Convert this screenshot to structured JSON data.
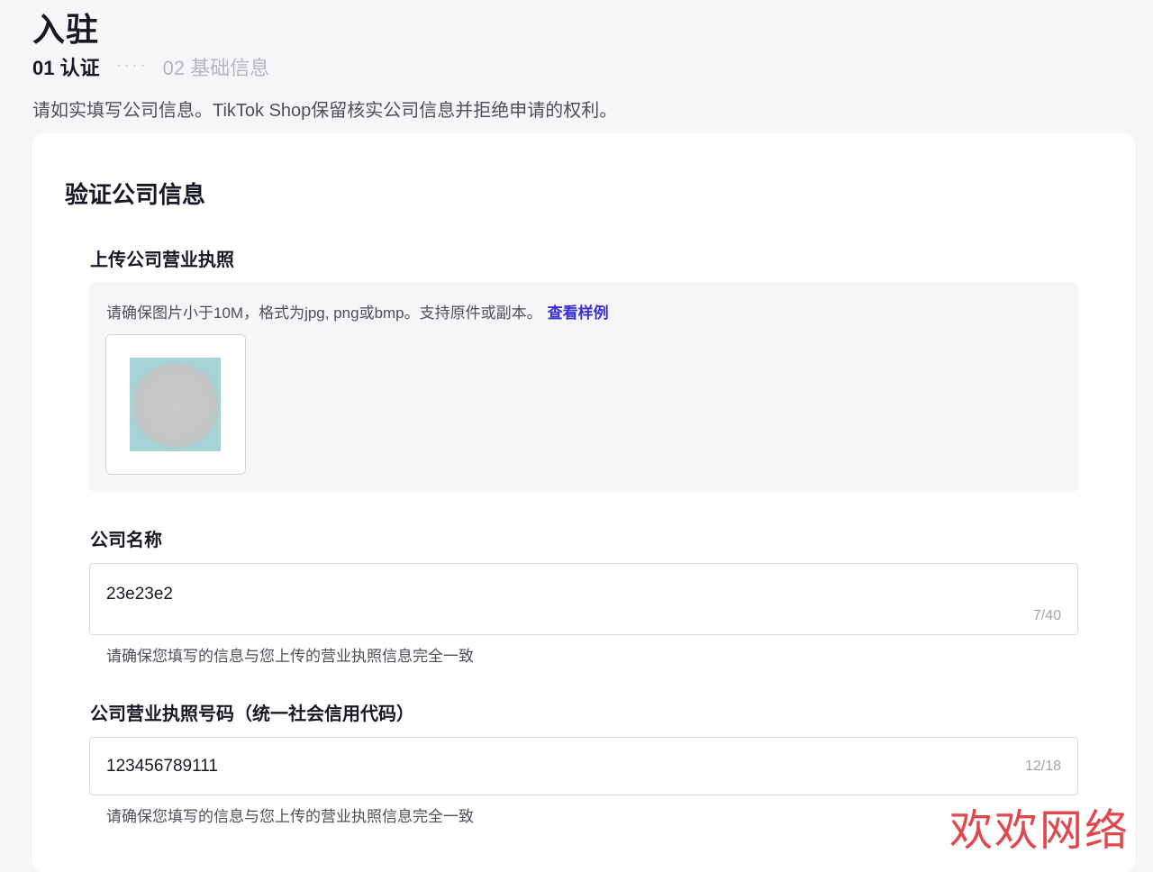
{
  "header": {
    "title": "入驻",
    "steps": [
      {
        "label": "01 认证",
        "active": true
      },
      {
        "label": "02 基础信息",
        "active": false
      }
    ],
    "step_separator": "····",
    "intro": "请如实填写公司信息。TikTok Shop保留核实公司信息并拒绝申请的权利。"
  },
  "card": {
    "title": "验证公司信息",
    "license_upload": {
      "label": "上传公司营业执照",
      "hint": "请确保图片小于10M，格式为jpg, png或bmp。支持原件或副本。",
      "link": "查看样例",
      "thumbnail": "uploaded-license-image"
    },
    "company_name": {
      "label": "公司名称",
      "value": "23e23e2",
      "counter": "7/40",
      "helper": "请确保您填写的信息与您上传的营业执照信息完全一致"
    },
    "license_number": {
      "label": "公司营业执照号码（统一社会信用代码）",
      "value": "123456789111",
      "counter": "12/18",
      "helper": "请确保您填写的信息与您上传的营业执照信息完全一致"
    }
  },
  "watermark": "欢欢网络",
  "colors": {
    "page_bg": "#f6f6f8",
    "card_bg": "#ffffff",
    "link": "#3a2fd6",
    "watermark": "#e0484c",
    "thumb_bg": "#a7d2d6"
  }
}
